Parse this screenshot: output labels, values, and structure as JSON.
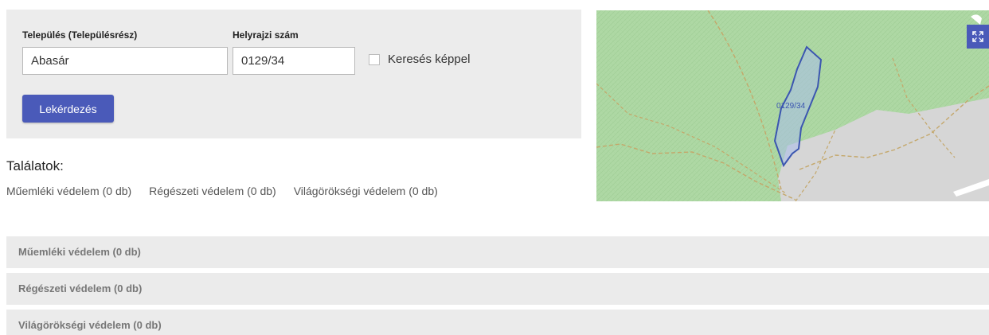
{
  "search": {
    "settlement_label": "Település (Településrész)",
    "settlement_value": "Abasár",
    "parcel_label": "Helyrajzi szám",
    "parcel_value": "0129/34",
    "image_search_label": "Keresés képpel",
    "image_search_checked": false,
    "query_button_label": "Lekérdezés"
  },
  "results": {
    "title": "Találatok:",
    "links": [
      "Műemléki védelem (0 db)",
      "Régészeti védelem (0 db)",
      "Világörökségi védelem (0 db)"
    ]
  },
  "map": {
    "parcel_label": "0129/34",
    "fullscreen_icon": "expand-icon",
    "colors": {
      "forest": "#aed8a4",
      "parcel_outline": "#3b56b0",
      "road": "#d6d6d6"
    }
  },
  "accordions": [
    "Műemléki védelem (0 db)",
    "Régészeti védelem (0 db)",
    "Világörökségi védelem (0 db)"
  ],
  "colors": {
    "accent": "#4a5ab9",
    "panel_background": "#ececec"
  }
}
